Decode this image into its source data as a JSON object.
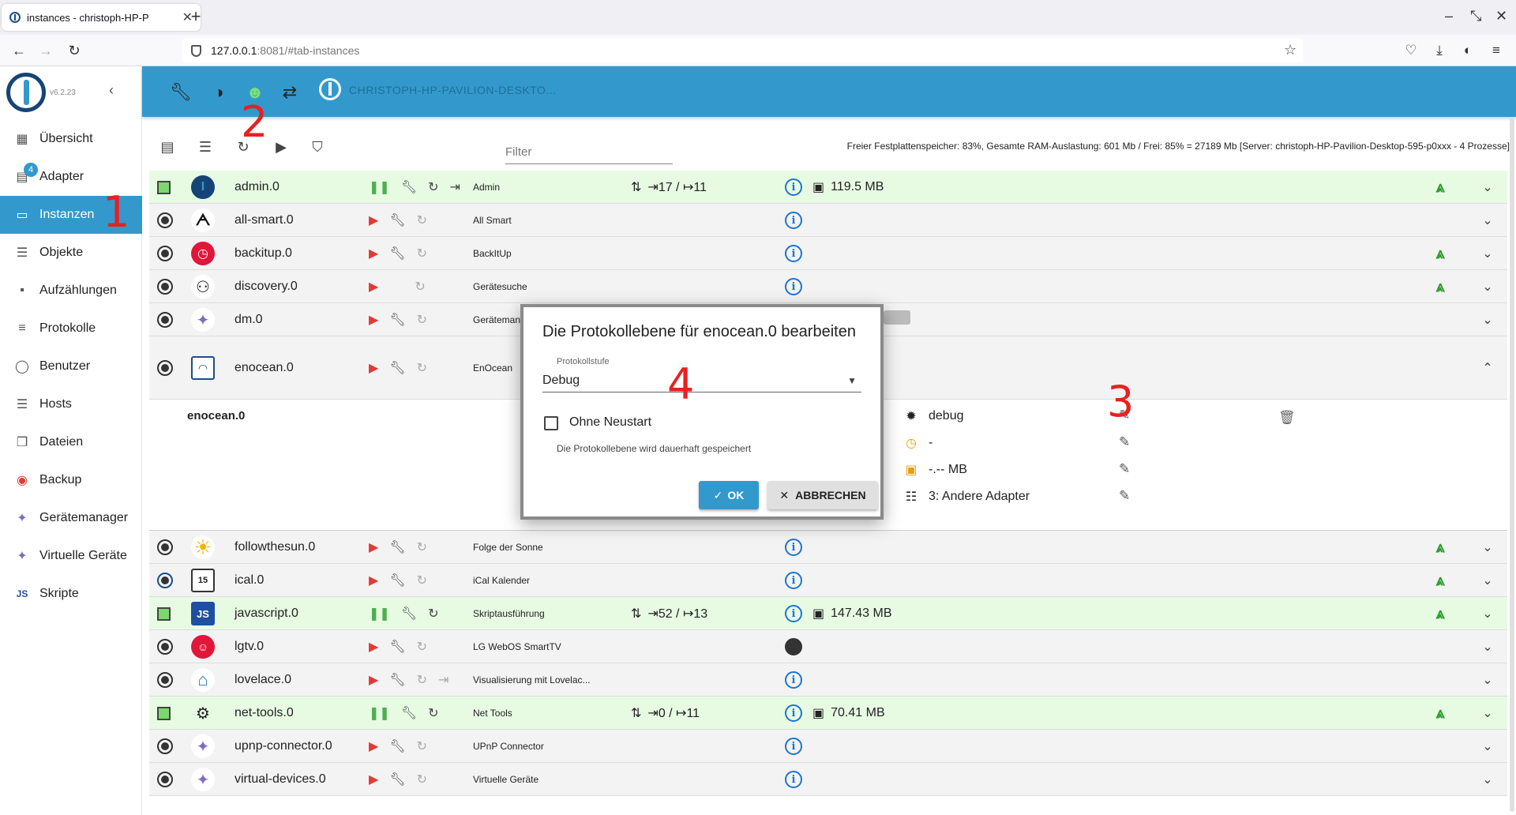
{
  "browser": {
    "tab_title": "instances - christoph-HP-P",
    "url_host": "127.0.0.1",
    "url_path": ":8081/#tab-instances"
  },
  "sidebar": {
    "version": "v6.2.23",
    "items": [
      {
        "label": "Übersicht",
        "icon": "grid-icon"
      },
      {
        "label": "Adapter",
        "icon": "store-icon",
        "badge": "4"
      },
      {
        "label": "Instanzen",
        "icon": "instances-icon",
        "active": true
      },
      {
        "label": "Objekte",
        "icon": "list-icon"
      },
      {
        "label": "Aufzählungen",
        "icon": "enum-icon"
      },
      {
        "label": "Protokolle",
        "icon": "log-icon"
      },
      {
        "label": "Benutzer",
        "icon": "user-icon"
      },
      {
        "label": "Hosts",
        "icon": "host-icon"
      },
      {
        "label": "Dateien",
        "icon": "file-icon"
      },
      {
        "label": "Backup",
        "icon": "backup-icon"
      },
      {
        "label": "Gerätemanager",
        "icon": "device-icon"
      },
      {
        "label": "Virtuelle Geräte",
        "icon": "virtual-device-icon"
      },
      {
        "label": "Skripte",
        "icon": "js-icon"
      }
    ]
  },
  "header": {
    "hostname": "CHRISTOPH-HP-PAVILION-DESKTO..."
  },
  "toolbar": {
    "filter_placeholder": "Filter",
    "sysinfo": "Freier Festplattenspeicher: 83%, Gesamte RAM-Auslastung: 601 Mb / Frei: 85% = 27189 Mb [Server: christoph-HP-Pavilion-Desktop-595-p0xxx - 4 Prozesse]"
  },
  "instances": [
    {
      "name": "admin.0",
      "desc": "Admin",
      "running": true,
      "io": "⇥17 / ↦11",
      "mem": "119.5 MB",
      "signal": true
    },
    {
      "name": "all-smart.0",
      "desc": "All Smart",
      "running": false,
      "signal": false
    },
    {
      "name": "backitup.0",
      "desc": "BackItUp",
      "running": false,
      "signal": true
    },
    {
      "name": "discovery.0",
      "desc": "Gerätesuche",
      "running": false,
      "signal": true
    },
    {
      "name": "dm.0",
      "desc": "Gerätemanager",
      "running": false,
      "signal": false
    },
    {
      "name": "enocean.0",
      "desc": "EnOcean",
      "running": false,
      "signal": false,
      "expanded": true
    },
    {
      "name": "followthesun.0",
      "desc": "Folge der Sonne",
      "running": false,
      "signal": true
    },
    {
      "name": "ical.0",
      "desc": "iCal Kalender",
      "running": false,
      "signal": true
    },
    {
      "name": "javascript.0",
      "desc": "Skriptausführung",
      "running": true,
      "io": "⇥52 / ↦13",
      "mem": "147.43 MB",
      "signal": true
    },
    {
      "name": "lgtv.0",
      "desc": "LG WebOS SmartTV",
      "running": false,
      "signal": false
    },
    {
      "name": "lovelace.0",
      "desc": "Visualisierung mit Lovelac...",
      "running": false,
      "signal": false
    },
    {
      "name": "net-tools.0",
      "desc": "Net Tools",
      "running": true,
      "io": "⇥0 / ↦11",
      "mem": "70.41 MB",
      "signal": true
    },
    {
      "name": "upnp-connector.0",
      "desc": "UPnP Connector",
      "running": false,
      "signal": false
    },
    {
      "name": "virtual-devices.0",
      "desc": "Virtuelle Geräte",
      "running": false,
      "signal": false
    }
  ],
  "detail": {
    "title": "enocean.0",
    "log_level": "debug",
    "schedule": "-",
    "memory_limit": "-.-- MB",
    "start_order": "3: Andere Adapter"
  },
  "dialog": {
    "title": "Die Protokollebene für enocean.0 bearbeiten",
    "field_label": "Protokollstufe",
    "selected": "Debug",
    "checkbox_label": "Ohne Neustart",
    "hint": "Die Protokollebene wird dauerhaft gespeichert",
    "ok_label": "OK",
    "cancel_label": "ABBRECHEN"
  },
  "annotations": [
    "1",
    "2",
    "3",
    "4"
  ],
  "colors": {
    "accent": "#3399cc",
    "running_bg": "#e7fbe3",
    "stopped_bg": "#f3f3f3",
    "annotation": "#e82020"
  }
}
